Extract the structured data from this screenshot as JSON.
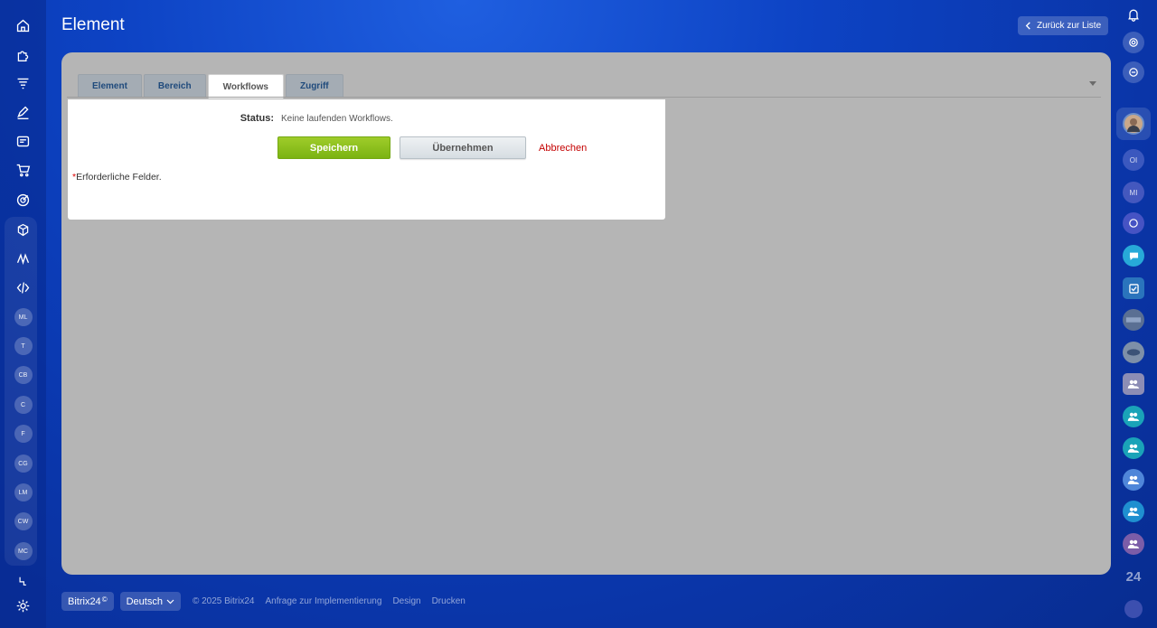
{
  "header": {
    "title": "Element",
    "back_label": "Zurück zur Liste"
  },
  "tabs": [
    {
      "label": "Element"
    },
    {
      "label": "Bereich"
    },
    {
      "label": "Workflows"
    },
    {
      "label": "Zugriff"
    }
  ],
  "form": {
    "status_label": "Status:",
    "status_value": "Keine laufenden Workflows.",
    "save_label": "Speichern",
    "apply_label": "Übernehmen",
    "cancel_label": "Abbrechen",
    "required_star": "*",
    "required_note": "Erforderliche Felder."
  },
  "left_sidebar": {
    "icons": [
      "home-icon",
      "puzzle-icon",
      "funnel-icon",
      "pen-icon",
      "news-icon",
      "cart-icon",
      "target-icon",
      "box-icon",
      "logo-icon",
      "code-icon"
    ],
    "groups": [
      "ML",
      "T",
      "CB",
      "C",
      "F",
      "CG",
      "LM",
      "CW",
      "MC"
    ],
    "bottom_icons": [
      "pulse-icon",
      "settings-icon"
    ]
  },
  "right_sidebar": {
    "initials_1": "OI",
    "initials_2": "MI",
    "logo_label": "24"
  },
  "footer": {
    "brand": "Bitrix24",
    "brand_mark": "©",
    "language": "Deutsch",
    "copyright": "© 2025 Bitrix24",
    "links": [
      "Anfrage zur Implementierung",
      "Design",
      "Drucken"
    ]
  },
  "colors": {
    "accent_green": "#86bd1c",
    "cancel_red": "#c40000",
    "tab_text": "#1f4a7c"
  }
}
